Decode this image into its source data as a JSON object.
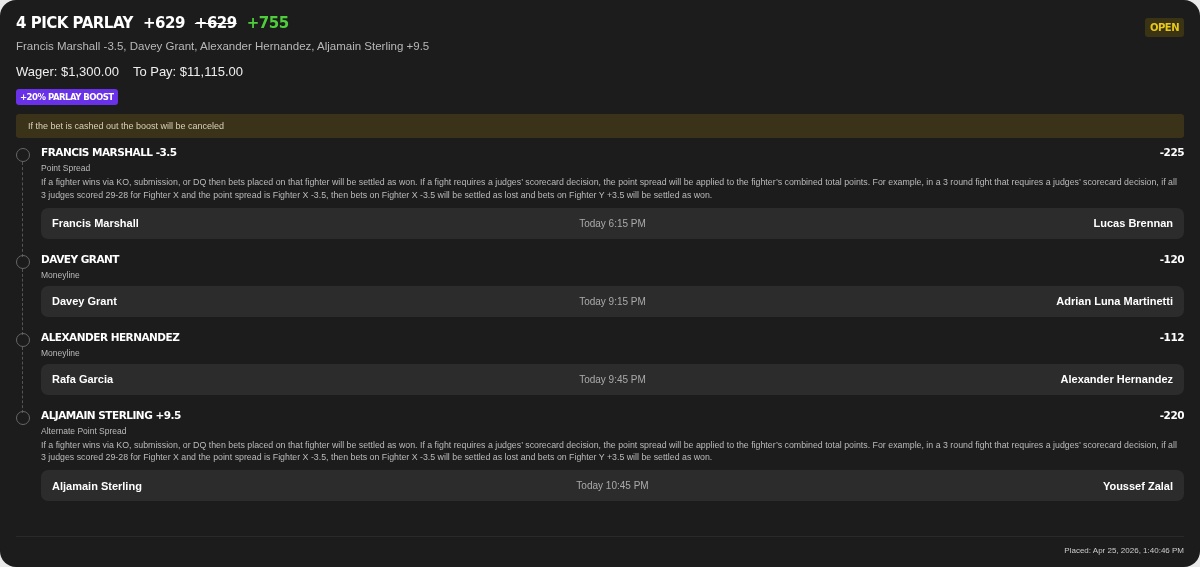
{
  "bet": {
    "title": "4 PICK PARLAY",
    "odds": [
      {
        "text": "+629",
        "kind": "original"
      },
      {
        "text": "+629",
        "kind": "struck"
      },
      {
        "text": "+755",
        "kind": "boosted"
      }
    ],
    "status": "OPEN",
    "summary": "Francis Marshall -3.5, Davey Grant, Alexander Hernandez, Aljamain Sterling +9.5",
    "wager": "Wager: $1,300.00",
    "to_pay": "To Pay: $11,115.00",
    "boost_badge": "+20% PARLAY BOOST",
    "notice": "If the bet is cashed out the boost will be canceled"
  },
  "legs": [
    {
      "pick": "FRANCIS MARSHALL -3.5",
      "odds": "-225",
      "market": "Point Spread",
      "rules": "If a fighter wins via KO, submission, or DQ then bets placed on that fighter will be settled as won. If a fight requires a judges’ scorecard decision, the point spread will be applied to the fighter’s combined total points. For example, in a 3 round fight that requires a judges’ scorecard decision, if all 3 judges scored 29-28 for Fighter X and the point spread is Fighter X -3.5, then bets on Fighter X -3.5 will be settled as lost and bets on Fighter Y +3.5 will be settled as won.",
      "fighter_1": "Francis Marshall",
      "time": "Today 6:15 PM",
      "fighter_2": "Lucas Brennan"
    },
    {
      "pick": "DAVEY GRANT",
      "odds": "-120",
      "market": "Moneyline",
      "fighter_1": "Davey Grant",
      "time": "Today 9:15 PM",
      "fighter_2": "Adrian Luna Martinetti"
    },
    {
      "pick": "ALEXANDER HERNANDEZ",
      "odds": "-112",
      "market": "Moneyline",
      "fighter_1": "Rafa Garcia",
      "time": "Today 9:45 PM",
      "fighter_2": "Alexander Hernandez"
    },
    {
      "pick": "ALJAMAIN STERLING +9.5",
      "odds": "-220",
      "market": "Alternate Point Spread",
      "rules": "If a fighter wins via KO, submission, or DQ then bets placed on that fighter will be settled as won. If a fight requires a judges’ scorecard decision, the point spread will be applied to the fighter’s combined total points. For example, in a 3 round fight that requires a judges’ scorecard decision, if all 3 judges scored 29-28 for Fighter X and the point spread is Fighter X -3.5, then bets on Fighter X -3.5 will be settled as lost and bets on Fighter Y +3.5 will be settled as won.",
      "fighter_1": "Aljamain Sterling",
      "time": "Today 10:45 PM",
      "fighter_2": "Youssef Zalal"
    }
  ],
  "placed": "Placed: Apr 25, 2026, 1:40:46 PM"
}
